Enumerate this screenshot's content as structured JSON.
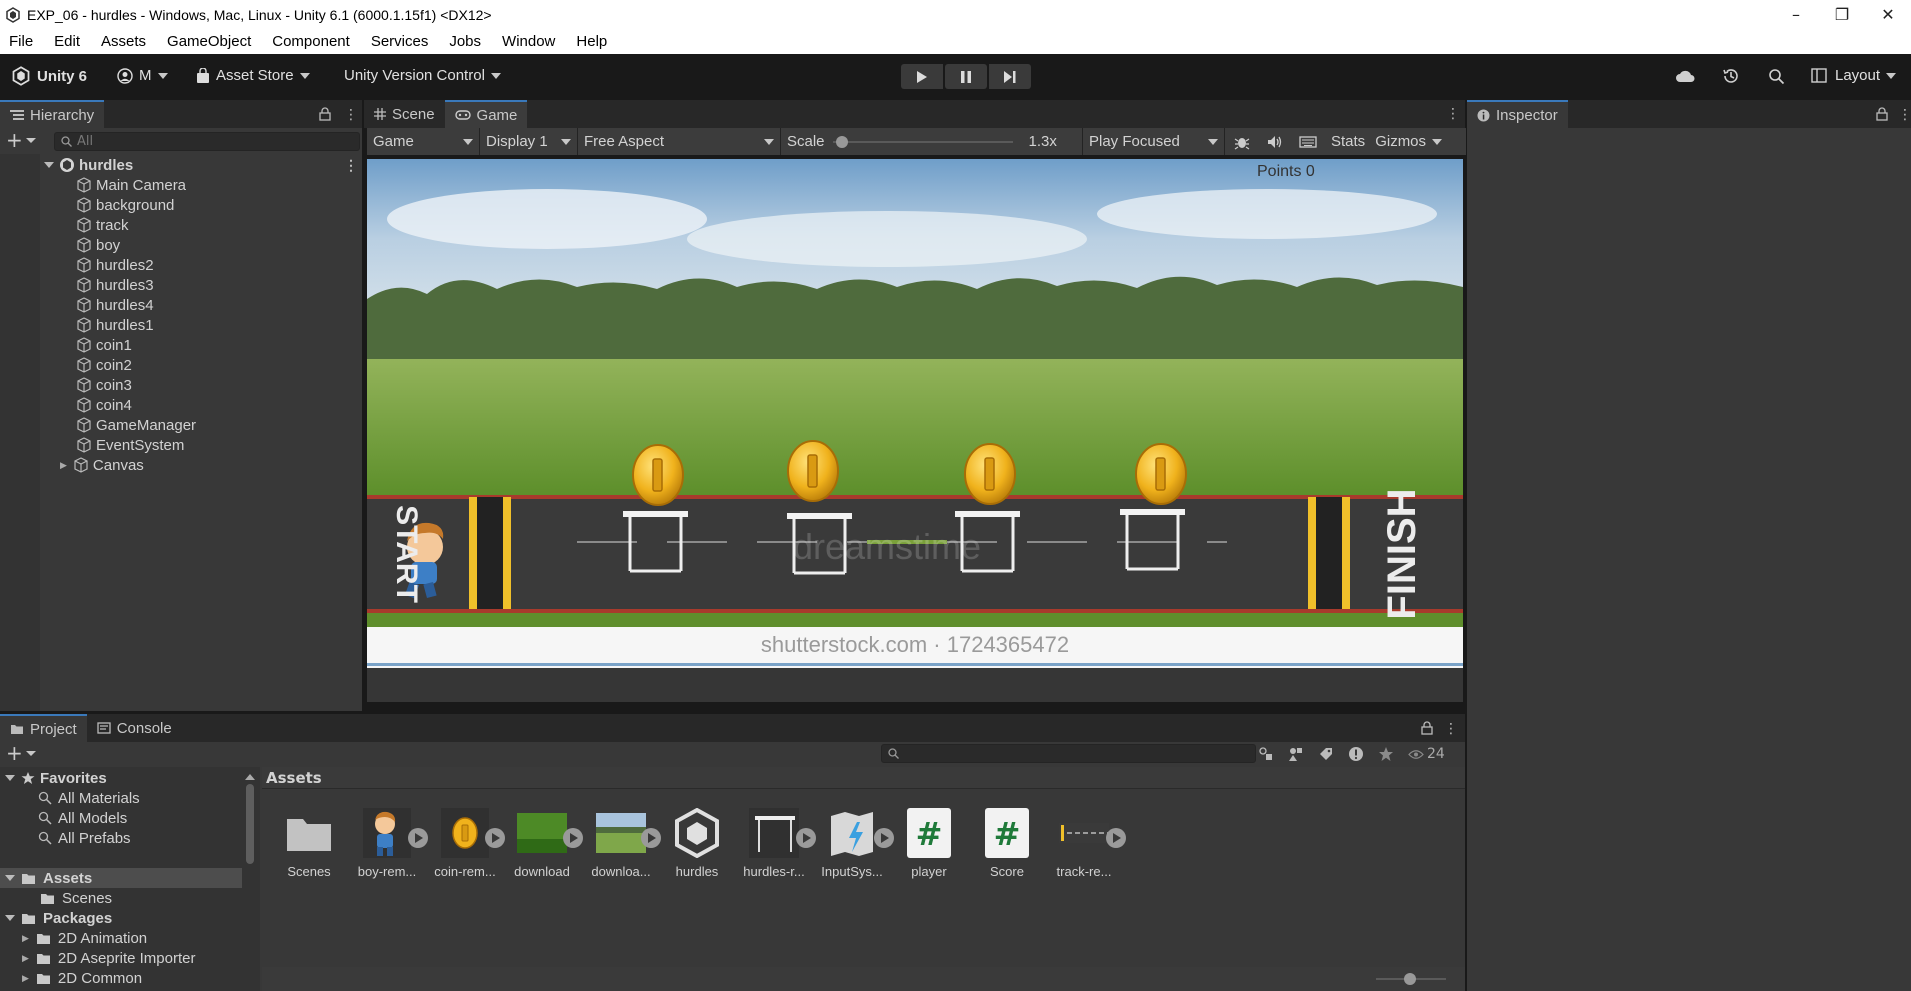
{
  "window": {
    "title": "EXP_06 - hurdles - Windows, Mac, Linux - Unity 6.1 (6000.1.15f1) <DX12>"
  },
  "menu": [
    "File",
    "Edit",
    "Assets",
    "GameObject",
    "Component",
    "Services",
    "Jobs",
    "Window",
    "Help"
  ],
  "toolbar": {
    "unity_label": "Unity 6",
    "account_label": "M",
    "asset_store_label": "Asset Store",
    "version_control_label": "Unity Version Control",
    "layout_label": "Layout"
  },
  "hierarchy": {
    "tab_label": "Hierarchy",
    "search_placeholder": "All",
    "scene_name": "hurdles",
    "items": [
      "Main Camera",
      "background",
      "track",
      "boy",
      "hurdles2",
      "hurdles3",
      "hurdles4",
      "hurdles1",
      "coin1",
      "coin2",
      "coin3",
      "coin4",
      "GameManager",
      "EventSystem",
      "Canvas"
    ]
  },
  "center_tabs": {
    "scene_label": "Scene",
    "game_label": "Game"
  },
  "game_toolbar": {
    "mode": "Game",
    "display": "Display 1",
    "aspect": "Free Aspect",
    "scale_label": "Scale",
    "scale_value": "1.3x",
    "play_focus": "Play Focused",
    "stats_label": "Stats",
    "gizmos_label": "Gizmos",
    "scale_level": 0.02
  },
  "game": {
    "points_text": "Points 0",
    "start_text": "START",
    "finish_text": "FINISH",
    "watermark_text": "dreamstime",
    "bottom_text": "shutterstock.com · 1724365472"
  },
  "inspector": {
    "tab_label": "Inspector"
  },
  "bottom_tabs": {
    "project_label": "Project",
    "console_label": "Console"
  },
  "project": {
    "favorites_label": "Favorites",
    "favorites": [
      "All Materials",
      "All Models",
      "All Prefabs"
    ],
    "assets_label": "Assets",
    "assets_children": [
      "Scenes"
    ],
    "packages_label": "Packages",
    "packages": [
      "2D Animation",
      "2D Aseprite Importer",
      "2D Common"
    ],
    "breadcrumb": "Assets",
    "visible_count": "24",
    "asset_items": [
      "Scenes",
      "boy-rem...",
      "coin-rem...",
      "download",
      "downloa...",
      "hurdles",
      "hurdles-r...",
      "InputSys...",
      "player",
      "Score",
      "track-re..."
    ]
  },
  "colors": {
    "accent": "#3a79bb",
    "panel_bg": "#383838",
    "toolbar_bg": "#191919",
    "tab_bg": "#282828"
  }
}
